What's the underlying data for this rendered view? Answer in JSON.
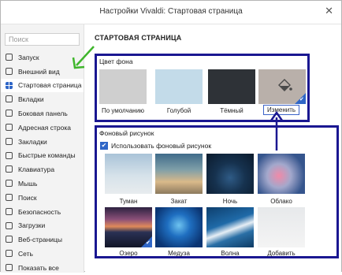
{
  "window": {
    "title": "Настройки Vivaldi: Стартовая страница",
    "close_glyph": "✕"
  },
  "sidebar": {
    "search_placeholder": "Поиск",
    "items": [
      {
        "label": "Запуск"
      },
      {
        "label": "Внешний вид"
      },
      {
        "label": "Стартовая страница",
        "active": true
      },
      {
        "label": "Вкладки"
      },
      {
        "label": "Боковая панель"
      },
      {
        "label": "Адресная строка"
      },
      {
        "label": "Закладки"
      },
      {
        "label": "Быстрые команды"
      },
      {
        "label": "Клавиатура"
      },
      {
        "label": "Мышь"
      },
      {
        "label": "Поиск"
      },
      {
        "label": "Безопасность"
      },
      {
        "label": "Загрузки"
      },
      {
        "label": "Веб-страницы"
      },
      {
        "label": "Сеть"
      },
      {
        "label": "Показать все"
      }
    ]
  },
  "main": {
    "section_title": "СТАРТОВАЯ СТРАНИЦА",
    "bg_color": {
      "label": "Цвет фона",
      "swatches": [
        {
          "caption": "По умолчанию",
          "color": "#cfcfcf"
        },
        {
          "caption": "Голубой",
          "color": "#c3dbe9"
        },
        {
          "caption": "Тёмный",
          "color": "#2e3237"
        },
        {
          "caption": "",
          "color": "#b9b0aa",
          "selected": true
        }
      ],
      "change_button": "Изменить"
    },
    "bg_image": {
      "label": "Фоновый рисунок",
      "checkbox_label": "Использовать фоновый рисунок",
      "checkbox_checked": true,
      "images": [
        {
          "caption": "Туман"
        },
        {
          "caption": "Закат"
        },
        {
          "caption": "Ночь"
        },
        {
          "caption": "Облако"
        },
        {
          "caption": "Озеро",
          "selected": true
        },
        {
          "caption": "Медуза"
        },
        {
          "caption": "Волна"
        },
        {
          "caption": "Добавить"
        }
      ]
    }
  },
  "colors": {
    "accent": "#2f66c7",
    "highlight_box": "#1a1791",
    "annotation_arrow_green": "#3fb62c"
  }
}
